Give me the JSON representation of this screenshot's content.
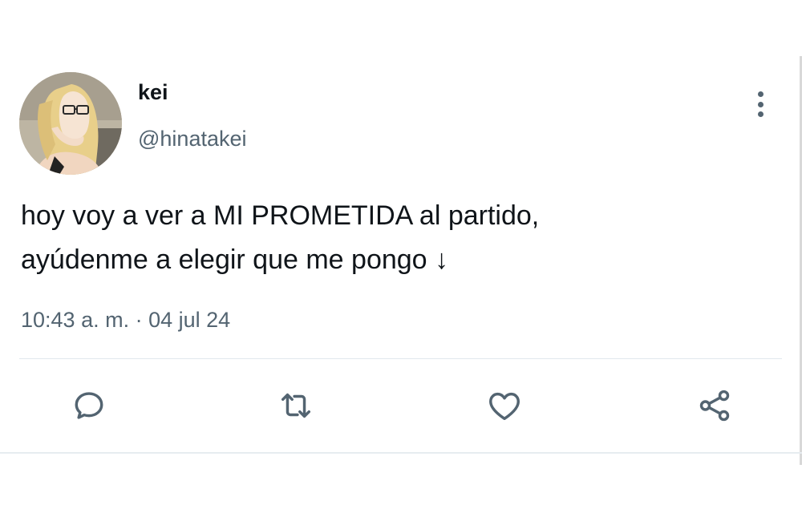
{
  "tweet": {
    "author": {
      "display_name": "kei",
      "handle": "@hinatakei",
      "avatar_icon": "anime-avatar"
    },
    "text_lines": [
      "hoy voy a ver a MI PROMETIDA al partido,",
      "ayúdenme a elegir que me pongo ↓"
    ],
    "timestamp": "10:43 a. m. · 04 jul 24",
    "menu_icon": "more-vertical-icon",
    "actions": {
      "reply_icon": "reply-icon",
      "retweet_icon": "retweet-icon",
      "like_icon": "heart-icon",
      "share_icon": "share-icon"
    },
    "colors": {
      "text": "#0f1419",
      "secondary": "#536471",
      "divider": "#e1e8ed"
    }
  }
}
